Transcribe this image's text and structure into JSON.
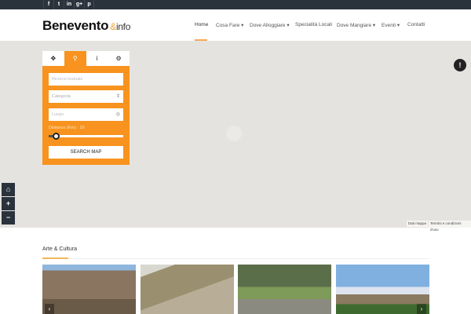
{
  "topbar": {
    "social": [
      {
        "icon": "facebook-icon",
        "glyph": "f"
      },
      {
        "icon": "twitter-icon",
        "glyph": "t"
      },
      {
        "icon": "linkedin-icon",
        "glyph": "in"
      },
      {
        "icon": "google-plus-icon",
        "glyph": "g+"
      },
      {
        "icon": "pinterest-icon",
        "glyph": "p"
      }
    ]
  },
  "header": {
    "logo": {
      "main": "Benevento",
      "amp": "&",
      "suffix": "info"
    },
    "nav": [
      {
        "label": "Home"
      },
      {
        "label": "Cosa Fare ▾"
      },
      {
        "label": "Dove Alloggiare ▾"
      },
      {
        "label": "Specialità Locali"
      },
      {
        "label": "Dove Mangiare ▾"
      },
      {
        "label": "Eventi ▾"
      },
      {
        "label": "Contatti"
      }
    ]
  },
  "search_panel": {
    "tabs": [
      "✥",
      "⚲",
      "i",
      "⚙"
    ],
    "text_placeholder": "Ricerca testuale",
    "category": "Categoria",
    "location_placeholder": "Luogo",
    "distance_label": "Distance (Km) : 10",
    "distance_value": 10,
    "distance_fraction": 0.1,
    "button": "SEARCH MAP"
  },
  "map": {
    "controls": [
      "⌂",
      "+",
      "−"
    ],
    "info": "!",
    "attribution": [
      "Dati mappa",
      "Termini e condizioni d'uso"
    ]
  },
  "section": {
    "title": "Arte & Cultura",
    "prev": "‹",
    "next": "›"
  },
  "colors": {
    "accent": "#f7931e",
    "dark": "#2a323c"
  }
}
